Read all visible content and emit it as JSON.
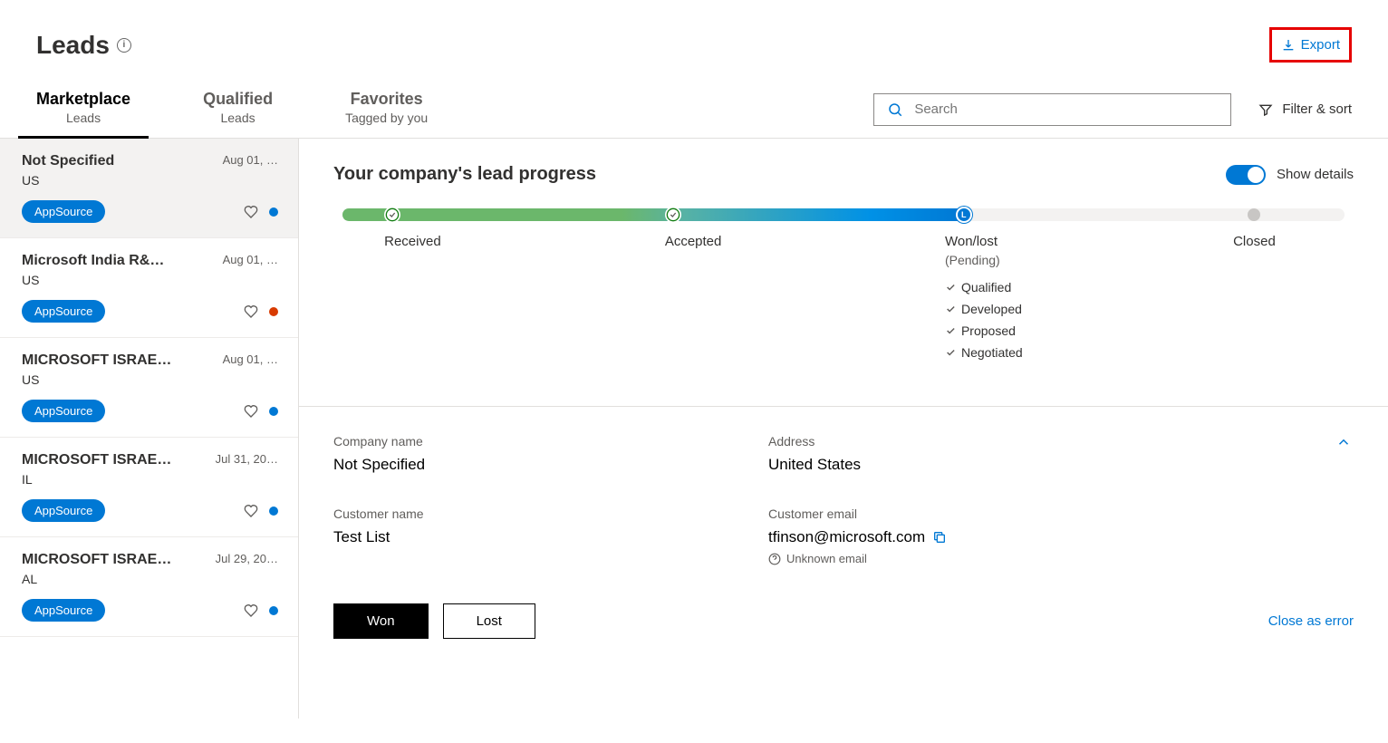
{
  "header": {
    "title": "Leads",
    "export": "Export"
  },
  "tabs": [
    {
      "title": "Marketplace",
      "sub": "Leads"
    },
    {
      "title": "Qualified",
      "sub": "Leads"
    },
    {
      "title": "Favorites",
      "sub": "Tagged by you"
    }
  ],
  "search": {
    "placeholder": "Search"
  },
  "filter_sort": "Filter & sort",
  "leads": [
    {
      "title": "Not Specified",
      "date": "Aug 01, …",
      "loc": "US",
      "src": "AppSource",
      "dot": "blue"
    },
    {
      "title": "Microsoft India R&…",
      "date": "Aug 01, …",
      "loc": "US",
      "src": "AppSource",
      "dot": "orange"
    },
    {
      "title": "MICROSOFT ISRAE…",
      "date": "Aug 01, …",
      "loc": "US",
      "src": "AppSource",
      "dot": "blue"
    },
    {
      "title": "MICROSOFT ISRAE…",
      "date": "Jul 31, 20…",
      "loc": "IL",
      "src": "AppSource",
      "dot": "blue"
    },
    {
      "title": "MICROSOFT ISRAE…",
      "date": "Jul 29, 20…",
      "loc": "AL",
      "src": "AppSource",
      "dot": "blue"
    }
  ],
  "progress": {
    "title": "Your company's lead progress",
    "toggle_label": "Show details",
    "stages": {
      "received": "Received",
      "accepted": "Accepted",
      "wonlost": "Won/lost",
      "wonlost_sub": "(Pending)",
      "closed": "Closed"
    },
    "checklist": [
      "Qualified",
      "Developed",
      "Proposed",
      "Negotiated"
    ]
  },
  "details": {
    "company_label": "Company name",
    "company": "Not Specified",
    "address_label": "Address",
    "address": "United States",
    "customer_label": "Customer name",
    "customer": "Test List",
    "email_label": "Customer email",
    "email": "tfinson@microsoft.com",
    "email_note": "Unknown email"
  },
  "actions": {
    "won": "Won",
    "lost": "Lost",
    "close_error": "Close as error"
  }
}
